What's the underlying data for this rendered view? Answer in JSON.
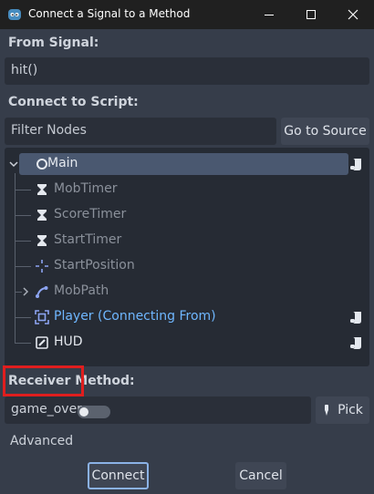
{
  "window": {
    "title": "Connect a Signal to a Method"
  },
  "from_signal": {
    "label": "From Signal:",
    "value": "hit()"
  },
  "connect_to_script": {
    "label": "Connect to Script:",
    "filter_placeholder": "Filter Nodes",
    "go_to_source_label": "Go to Source"
  },
  "tree": {
    "nodes": [
      {
        "label": "Main",
        "icon": "node-circle-icon",
        "state": "selected",
        "script": true
      },
      {
        "label": "MobTimer",
        "icon": "timer-icon",
        "state": "disabled"
      },
      {
        "label": "ScoreTimer",
        "icon": "timer-icon",
        "state": "disabled"
      },
      {
        "label": "StartTimer",
        "icon": "timer-icon",
        "state": "disabled"
      },
      {
        "label": "StartPosition",
        "icon": "marker2d-icon",
        "state": "disabled"
      },
      {
        "label": "MobPath",
        "icon": "path2d-icon",
        "state": "disabled",
        "expandable": true
      },
      {
        "label": "Player (Connecting From)",
        "icon": "area2d-icon",
        "state": "source",
        "script": true
      },
      {
        "label": "HUD",
        "icon": "canvaslayer-icon",
        "state": "normal",
        "script": true
      }
    ]
  },
  "receiver_method": {
    "label": "Receiver Method:",
    "value": "game_over",
    "pick_label": "Pick"
  },
  "advanced": {
    "label": "Advanced",
    "enabled": false
  },
  "buttons": {
    "connect": "Connect",
    "cancel": "Cancel"
  },
  "colors": {
    "accent": "#8bb2e6",
    "source_blue": "#6fb7ff",
    "highlight_red": "#e01e1e",
    "selection": "#4a5870"
  }
}
